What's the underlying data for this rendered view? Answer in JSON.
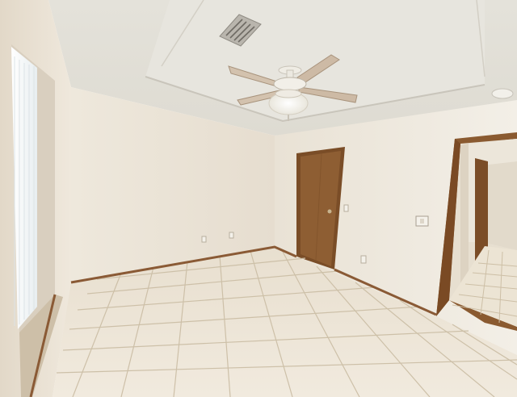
{
  "scene": {
    "kind": "empty bedroom interior photograph",
    "colors": {
      "ceiling": "#ecebe4",
      "ceiling_shadow": "#d8d6ce",
      "wall_left": "#efe8dc",
      "wall_back": "#ece5d8",
      "wall_right": "#efeae0",
      "floor_tile": "#eee6d8",
      "grout": "#cfc3ad",
      "baseboard": "#8a5a35",
      "door_wood": "#8b5a2f",
      "door_frame": "#7a4d27",
      "window_glass": "#f7fbfd",
      "fan_blade": "#c9b8a6"
    },
    "objects": [
      {
        "name": "ceiling-fan",
        "icon": "ceiling-fan-icon"
      },
      {
        "name": "air-vent",
        "icon": "vent-icon"
      },
      {
        "name": "closet-door",
        "icon": "door-icon"
      },
      {
        "name": "window-blinds",
        "icon": "blinds-icon"
      },
      {
        "name": "doorway-to-hall",
        "icon": "doorway-icon"
      },
      {
        "name": "light-switch",
        "icon": "switch-icon"
      },
      {
        "name": "tile-floor",
        "icon": "tile-icon"
      }
    ]
  }
}
